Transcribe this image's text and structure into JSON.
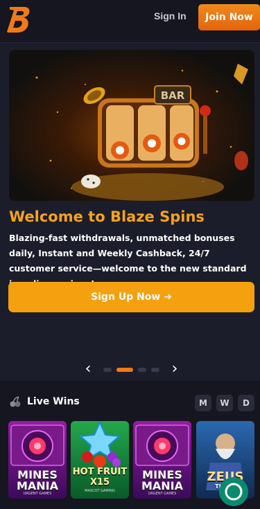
{
  "header": {
    "signin_label": "Sign In",
    "join_label": "Join Now"
  },
  "hero": {
    "title": "Welcome to Blaze Spins",
    "description": "Blazing-fast withdrawals, unmatched bonuses daily, Instant and Weekly Cashback, 24/7 customer service—welcome to the new standard in online casinos!",
    "slot_sign": "BAR",
    "cta_label": "Sign Up Now ➔"
  },
  "carousel": {
    "prev": "‹",
    "next": "›",
    "slides": 4,
    "active_index": 1
  },
  "live_wins": {
    "title": "Live Wins",
    "filters": [
      "M",
      "W",
      "D"
    ],
    "games": [
      {
        "title_line1": "MINES",
        "title_line2": "MANIA",
        "subtitle": "URGENT GAMES"
      },
      {
        "title_line1": "HOT FRUIT",
        "title_line2": "X15",
        "subtitle": "MASCOT GAMING"
      },
      {
        "title_line1": "MINES",
        "title_line2": "MANIA",
        "subtitle": "URGENT GAMES"
      },
      {
        "title_line1": "ZEUS",
        "title_line2": "THE ...",
        "subtitle": ""
      }
    ]
  },
  "colors": {
    "accent": "#f5a00f",
    "join": "#e4630c",
    "bg": "#15161f",
    "card": "#1c1d2a"
  }
}
